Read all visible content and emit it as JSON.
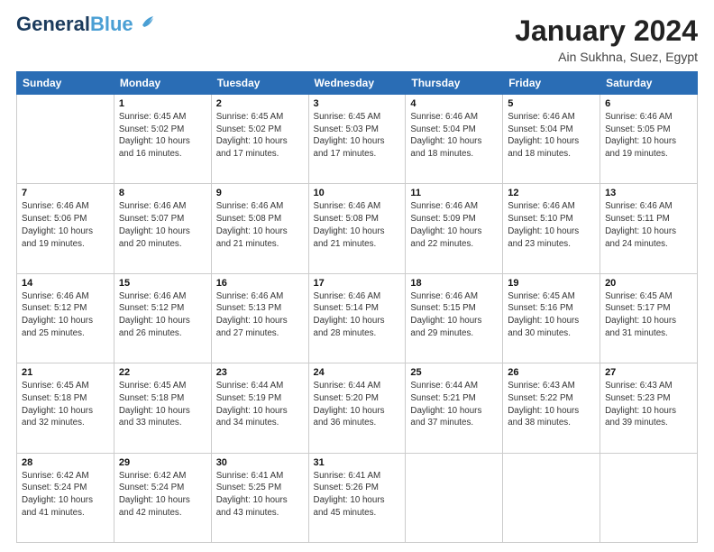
{
  "header": {
    "logo_line1": "General",
    "logo_line2": "Blue",
    "main_title": "January 2024",
    "subtitle": "Ain Sukhna, Suez, Egypt"
  },
  "days_of_week": [
    "Sunday",
    "Monday",
    "Tuesday",
    "Wednesday",
    "Thursday",
    "Friday",
    "Saturday"
  ],
  "weeks": [
    [
      {
        "day": "",
        "sunrise": "",
        "sunset": "",
        "daylight": ""
      },
      {
        "day": "1",
        "sunrise": "Sunrise: 6:45 AM",
        "sunset": "Sunset: 5:02 PM",
        "daylight": "Daylight: 10 hours and 16 minutes."
      },
      {
        "day": "2",
        "sunrise": "Sunrise: 6:45 AM",
        "sunset": "Sunset: 5:02 PM",
        "daylight": "Daylight: 10 hours and 17 minutes."
      },
      {
        "day": "3",
        "sunrise": "Sunrise: 6:45 AM",
        "sunset": "Sunset: 5:03 PM",
        "daylight": "Daylight: 10 hours and 17 minutes."
      },
      {
        "day": "4",
        "sunrise": "Sunrise: 6:46 AM",
        "sunset": "Sunset: 5:04 PM",
        "daylight": "Daylight: 10 hours and 18 minutes."
      },
      {
        "day": "5",
        "sunrise": "Sunrise: 6:46 AM",
        "sunset": "Sunset: 5:04 PM",
        "daylight": "Daylight: 10 hours and 18 minutes."
      },
      {
        "day": "6",
        "sunrise": "Sunrise: 6:46 AM",
        "sunset": "Sunset: 5:05 PM",
        "daylight": "Daylight: 10 hours and 19 minutes."
      }
    ],
    [
      {
        "day": "7",
        "sunrise": "Sunrise: 6:46 AM",
        "sunset": "Sunset: 5:06 PM",
        "daylight": "Daylight: 10 hours and 19 minutes."
      },
      {
        "day": "8",
        "sunrise": "Sunrise: 6:46 AM",
        "sunset": "Sunset: 5:07 PM",
        "daylight": "Daylight: 10 hours and 20 minutes."
      },
      {
        "day": "9",
        "sunrise": "Sunrise: 6:46 AM",
        "sunset": "Sunset: 5:08 PM",
        "daylight": "Daylight: 10 hours and 21 minutes."
      },
      {
        "day": "10",
        "sunrise": "Sunrise: 6:46 AM",
        "sunset": "Sunset: 5:08 PM",
        "daylight": "Daylight: 10 hours and 21 minutes."
      },
      {
        "day": "11",
        "sunrise": "Sunrise: 6:46 AM",
        "sunset": "Sunset: 5:09 PM",
        "daylight": "Daylight: 10 hours and 22 minutes."
      },
      {
        "day": "12",
        "sunrise": "Sunrise: 6:46 AM",
        "sunset": "Sunset: 5:10 PM",
        "daylight": "Daylight: 10 hours and 23 minutes."
      },
      {
        "day": "13",
        "sunrise": "Sunrise: 6:46 AM",
        "sunset": "Sunset: 5:11 PM",
        "daylight": "Daylight: 10 hours and 24 minutes."
      }
    ],
    [
      {
        "day": "14",
        "sunrise": "Sunrise: 6:46 AM",
        "sunset": "Sunset: 5:12 PM",
        "daylight": "Daylight: 10 hours and 25 minutes."
      },
      {
        "day": "15",
        "sunrise": "Sunrise: 6:46 AM",
        "sunset": "Sunset: 5:12 PM",
        "daylight": "Daylight: 10 hours and 26 minutes."
      },
      {
        "day": "16",
        "sunrise": "Sunrise: 6:46 AM",
        "sunset": "Sunset: 5:13 PM",
        "daylight": "Daylight: 10 hours and 27 minutes."
      },
      {
        "day": "17",
        "sunrise": "Sunrise: 6:46 AM",
        "sunset": "Sunset: 5:14 PM",
        "daylight": "Daylight: 10 hours and 28 minutes."
      },
      {
        "day": "18",
        "sunrise": "Sunrise: 6:46 AM",
        "sunset": "Sunset: 5:15 PM",
        "daylight": "Daylight: 10 hours and 29 minutes."
      },
      {
        "day": "19",
        "sunrise": "Sunrise: 6:45 AM",
        "sunset": "Sunset: 5:16 PM",
        "daylight": "Daylight: 10 hours and 30 minutes."
      },
      {
        "day": "20",
        "sunrise": "Sunrise: 6:45 AM",
        "sunset": "Sunset: 5:17 PM",
        "daylight": "Daylight: 10 hours and 31 minutes."
      }
    ],
    [
      {
        "day": "21",
        "sunrise": "Sunrise: 6:45 AM",
        "sunset": "Sunset: 5:18 PM",
        "daylight": "Daylight: 10 hours and 32 minutes."
      },
      {
        "day": "22",
        "sunrise": "Sunrise: 6:45 AM",
        "sunset": "Sunset: 5:18 PM",
        "daylight": "Daylight: 10 hours and 33 minutes."
      },
      {
        "day": "23",
        "sunrise": "Sunrise: 6:44 AM",
        "sunset": "Sunset: 5:19 PM",
        "daylight": "Daylight: 10 hours and 34 minutes."
      },
      {
        "day": "24",
        "sunrise": "Sunrise: 6:44 AM",
        "sunset": "Sunset: 5:20 PM",
        "daylight": "Daylight: 10 hours and 36 minutes."
      },
      {
        "day": "25",
        "sunrise": "Sunrise: 6:44 AM",
        "sunset": "Sunset: 5:21 PM",
        "daylight": "Daylight: 10 hours and 37 minutes."
      },
      {
        "day": "26",
        "sunrise": "Sunrise: 6:43 AM",
        "sunset": "Sunset: 5:22 PM",
        "daylight": "Daylight: 10 hours and 38 minutes."
      },
      {
        "day": "27",
        "sunrise": "Sunrise: 6:43 AM",
        "sunset": "Sunset: 5:23 PM",
        "daylight": "Daylight: 10 hours and 39 minutes."
      }
    ],
    [
      {
        "day": "28",
        "sunrise": "Sunrise: 6:42 AM",
        "sunset": "Sunset: 5:24 PM",
        "daylight": "Daylight: 10 hours and 41 minutes."
      },
      {
        "day": "29",
        "sunrise": "Sunrise: 6:42 AM",
        "sunset": "Sunset: 5:24 PM",
        "daylight": "Daylight: 10 hours and 42 minutes."
      },
      {
        "day": "30",
        "sunrise": "Sunrise: 6:41 AM",
        "sunset": "Sunset: 5:25 PM",
        "daylight": "Daylight: 10 hours and 43 minutes."
      },
      {
        "day": "31",
        "sunrise": "Sunrise: 6:41 AM",
        "sunset": "Sunset: 5:26 PM",
        "daylight": "Daylight: 10 hours and 45 minutes."
      },
      {
        "day": "",
        "sunrise": "",
        "sunset": "",
        "daylight": ""
      },
      {
        "day": "",
        "sunrise": "",
        "sunset": "",
        "daylight": ""
      },
      {
        "day": "",
        "sunrise": "",
        "sunset": "",
        "daylight": ""
      }
    ]
  ]
}
